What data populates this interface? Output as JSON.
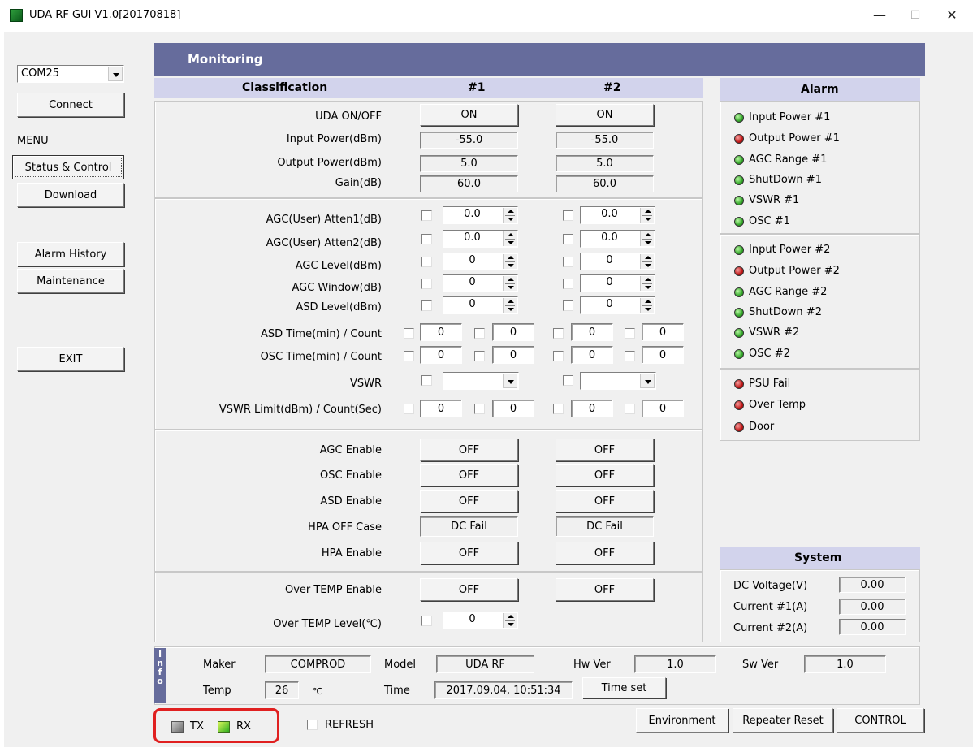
{
  "window": {
    "title": "UDA RF GUI V1.0[20170818]",
    "minimize": "—",
    "maximize": "☐",
    "close": "✕"
  },
  "left": {
    "com_port": "COM25",
    "connect": "Connect",
    "menu_label": "MENU",
    "status_control": "Status & Control",
    "download": "Download",
    "alarm_history": "Alarm History",
    "maintenance": "Maintenance",
    "exit": "EXIT"
  },
  "monitoring": {
    "title": "Monitoring",
    "col_classification": "Classification",
    "col_1": "#1",
    "col_2": "#2",
    "status_rows": [
      {
        "label": "UDA ON/OFF",
        "v1": "ON",
        "v2": "ON"
      },
      {
        "label": "Input Power(dBm)",
        "v1": "-55.0",
        "v2": "-55.0"
      },
      {
        "label": "Output Power(dBm)",
        "v1": "5.0",
        "v2": "5.0"
      },
      {
        "label": "Gain(dB)",
        "v1": "60.0",
        "v2": "60.0"
      }
    ],
    "spin_rows": [
      {
        "label": "AGC(User) Atten1(dB)",
        "v1": "0.0",
        "v2": "0.0"
      },
      {
        "label": "AGC(User) Atten2(dB)",
        "v1": "0.0",
        "v2": "0.0"
      },
      {
        "label": "AGC Level(dBm)",
        "v1": "0",
        "v2": "0"
      },
      {
        "label": "AGC Window(dB)",
        "v1": "0",
        "v2": "0"
      },
      {
        "label": "ASD Level(dBm)",
        "v1": "0",
        "v2": "0"
      }
    ],
    "pair_rows": [
      {
        "label": "ASD Time(min) / Count",
        "a1": "0",
        "b1": "0",
        "a2": "0",
        "b2": "0"
      },
      {
        "label": "OSC Time(min) / Count",
        "a1": "0",
        "b1": "0",
        "a2": "0",
        "b2": "0"
      }
    ],
    "vswr_label": "VSWR",
    "vswr1": "",
    "vswr2": "",
    "vswr_limit": {
      "label": "VSWR Limit(dBm) / Count(Sec)",
      "a1": "0",
      "b1": "0",
      "a2": "0",
      "b2": "0"
    },
    "enable_rows": [
      {
        "label": "AGC Enable",
        "v1": "OFF",
        "v2": "OFF"
      },
      {
        "label": "OSC Enable",
        "v1": "OFF",
        "v2": "OFF"
      },
      {
        "label": "ASD Enable",
        "v1": "OFF",
        "v2": "OFF"
      },
      {
        "label": "HPA OFF Case",
        "v1": "DC Fail",
        "v2": "DC Fail"
      },
      {
        "label": "HPA Enable",
        "v1": "OFF",
        "v2": "OFF"
      }
    ],
    "over_temp_enable": {
      "label": "Over TEMP Enable",
      "v1": "OFF",
      "v2": "OFF"
    },
    "over_temp_level": {
      "label": "Over TEMP Level(℃)",
      "v1": "0"
    }
  },
  "alarm": {
    "title": "Alarm",
    "group1": [
      {
        "label": "Input Power #1",
        "color": "green"
      },
      {
        "label": "Output Power #1",
        "color": "red"
      },
      {
        "label": "AGC Range #1",
        "color": "green"
      },
      {
        "label": "ShutDown #1",
        "color": "green"
      },
      {
        "label": "VSWR #1",
        "color": "green"
      },
      {
        "label": "OSC #1",
        "color": "green"
      }
    ],
    "group2": [
      {
        "label": "Input Power #2",
        "color": "green"
      },
      {
        "label": "Output Power #2",
        "color": "red"
      },
      {
        "label": "AGC Range #2",
        "color": "green"
      },
      {
        "label": "ShutDown #2",
        "color": "green"
      },
      {
        "label": "VSWR #2",
        "color": "green"
      },
      {
        "label": "OSC #2",
        "color": "green"
      }
    ],
    "group3": [
      {
        "label": "PSU Fail",
        "color": "red"
      },
      {
        "label": "Over Temp",
        "color": "red"
      },
      {
        "label": "Door",
        "color": "red"
      }
    ]
  },
  "system": {
    "title": "System",
    "dc_voltage_label": "DC Voltage(V)",
    "dc_voltage": "0.00",
    "current1_label": "Current #1(A)",
    "current1": "0.00",
    "current2_label": "Current #2(A)",
    "current2": "0.00"
  },
  "info": {
    "side": [
      "I",
      "n",
      "f",
      "o"
    ],
    "maker_label": "Maker",
    "maker": "COMPROD",
    "model_label": "Model",
    "model": "UDA RF",
    "hw_label": "Hw Ver",
    "hw": "1.0",
    "sw_label": "Sw Ver",
    "sw": "1.0",
    "temp_label": "Temp",
    "temp": "26",
    "temp_unit": "℃",
    "time_label": "Time",
    "time": "2017.09.04, 10:51:34",
    "time_set": "Time set"
  },
  "bottom": {
    "tx": "TX",
    "rx": "RX",
    "refresh": "REFRESH",
    "environment": "Environment",
    "repeater_reset": "Repeater Reset",
    "control": "CONTROL",
    "highlight_color": "#e02020"
  }
}
